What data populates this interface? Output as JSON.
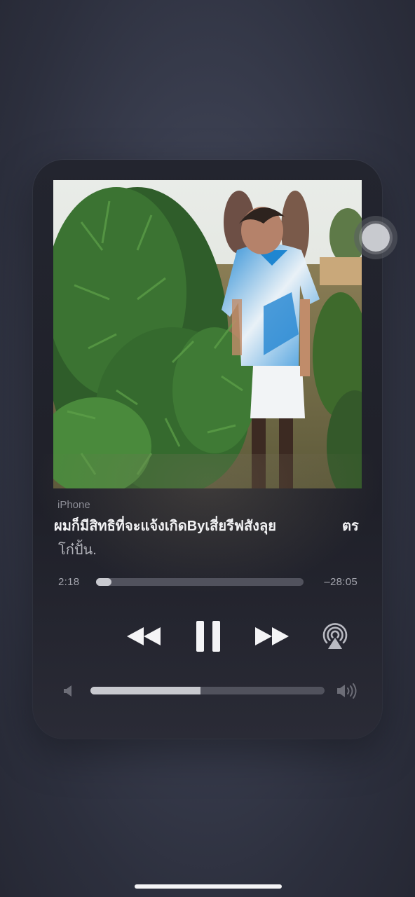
{
  "player": {
    "source": "iPhone",
    "title_main": "ผมก็มีสิทธิที่จะแจ้งเกิดByเสี่ยรีฟสังลุย",
    "title_overflow": "ตร",
    "artist": "โก๋ปั้น.",
    "elapsed": "2:18",
    "remaining": "–28:05",
    "progress_fraction": 0.075,
    "volume_fraction": 0.47
  },
  "icons": {
    "rewind": "rewind-icon",
    "pause": "pause-icon",
    "forward": "fast-forward-icon",
    "airplay": "airplay-icon",
    "volume_low": "speaker-low-icon",
    "volume_high": "speaker-high-icon"
  },
  "colors": {
    "accent": "#c8c9cf",
    "track": "#51525d",
    "text_primary": "#f2f2f4",
    "text_secondary": "#a3a4ad"
  }
}
